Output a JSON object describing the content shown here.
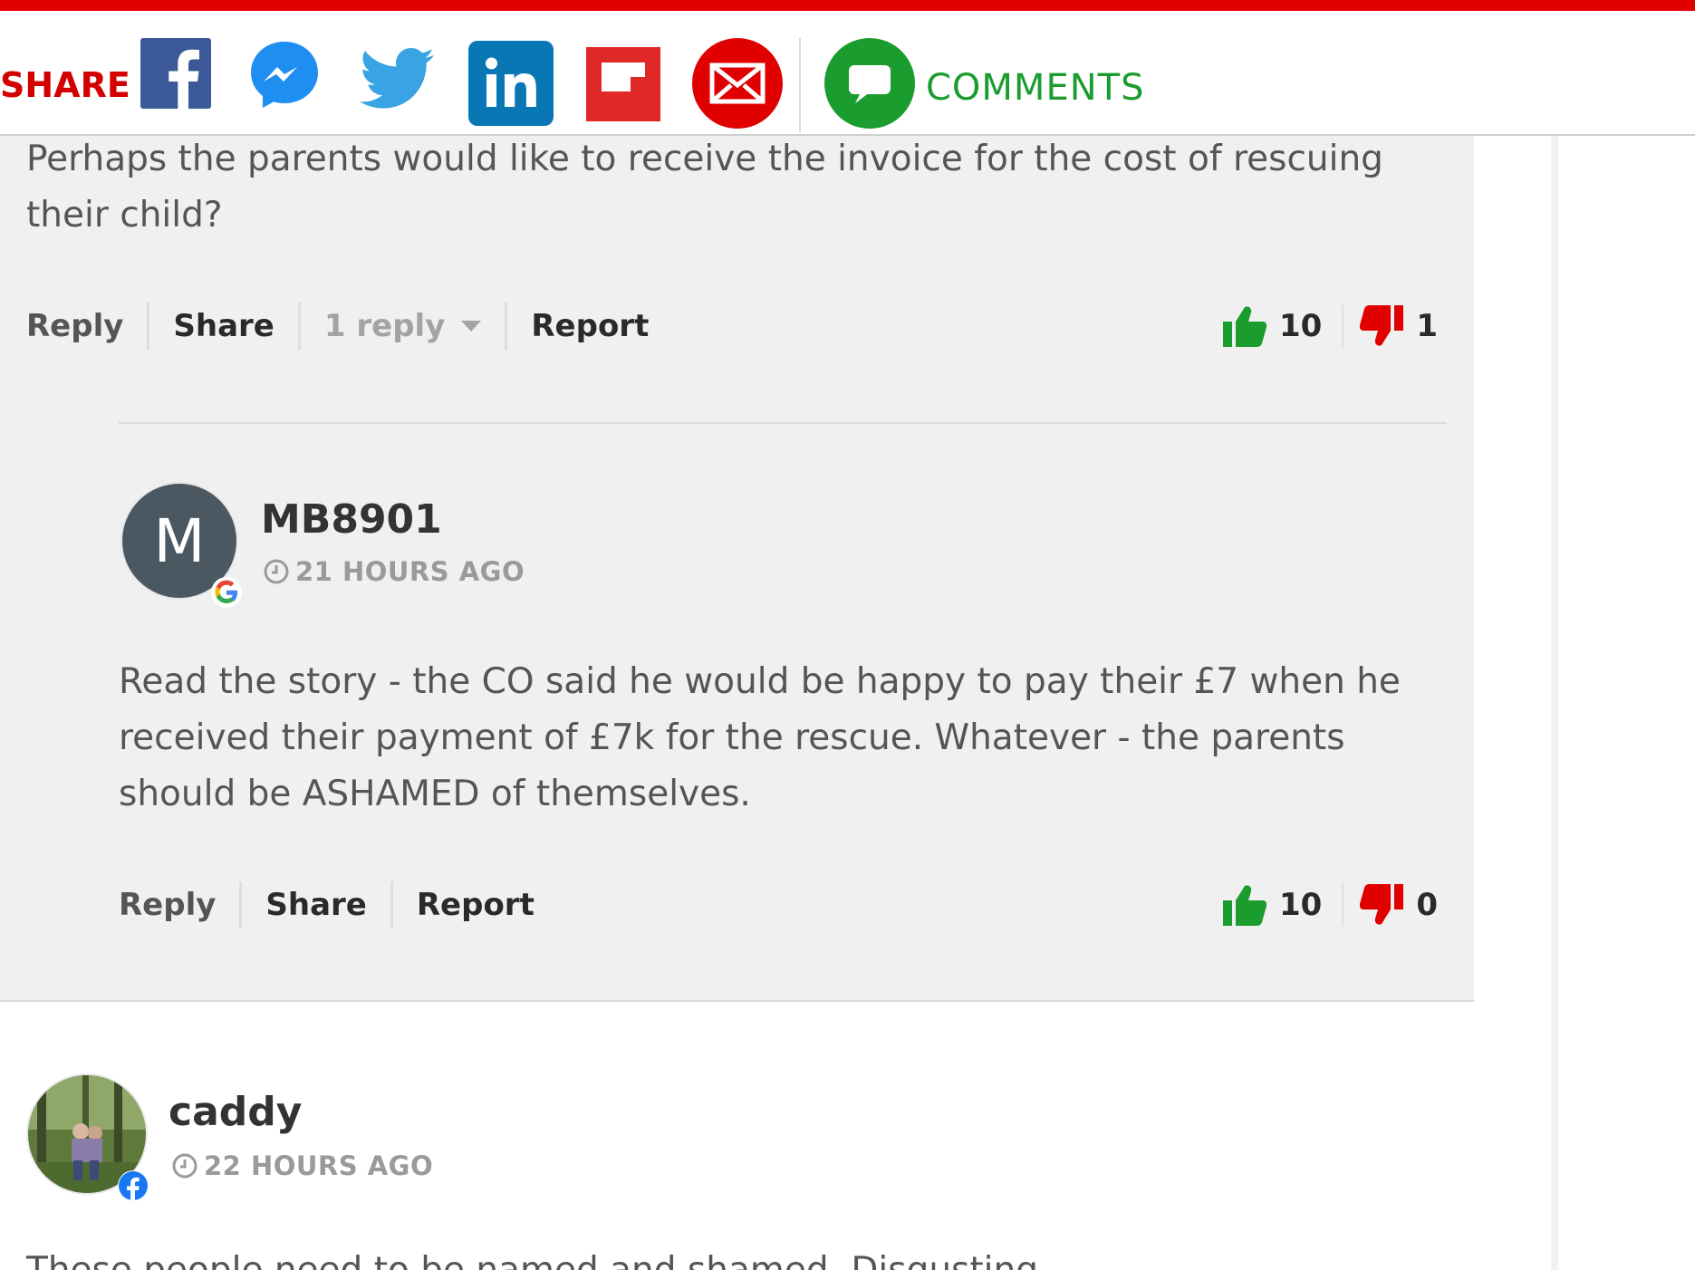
{
  "share_bar": {
    "share_label": "SHARE",
    "icons": [
      "facebook-icon",
      "messenger-icon",
      "twitter-icon",
      "linkedin-icon",
      "flipboard-icon",
      "email-icon",
      "comments-icon"
    ],
    "comments_label": "COMMENTS",
    "colors": {
      "facebook": "#3b5998",
      "messenger": "#1f8ef1",
      "twitter": "#3aa3e3",
      "linkedin": "#0a77b5",
      "flipboard": "#e12828",
      "email": "#e00000",
      "comments": "#1a9c2e",
      "share_label": "#d40000"
    }
  },
  "comments": [
    {
      "body": "Perhaps the parents would like to receive the invoice for the cost of rescuing their child?",
      "actions": {
        "reply": "Reply",
        "share": "Share",
        "replies": "1 reply",
        "report": "Report"
      },
      "upvotes": "10",
      "downvotes": "1",
      "replies": [
        {
          "username": "MB8901",
          "avatar_letter": "M",
          "login_provider": "google",
          "time": "21 HOURS AGO",
          "body": "Read the story - the CO said he would be happy to pay their £7 when he received their payment of £7k for the rescue. Whatever - the parents should be ASHAMED of themselves.",
          "actions": {
            "reply": "Reply",
            "share": "Share",
            "report": "Report"
          },
          "upvotes": "10",
          "downvotes": "0"
        }
      ]
    },
    {
      "username": "caddy",
      "login_provider": "facebook",
      "time": "22 HOURS AGO",
      "body": "These people need to be named and shamed. Disgusting."
    }
  ],
  "vote_colors": {
    "up": "#1a9c2e",
    "down": "#e00000"
  }
}
